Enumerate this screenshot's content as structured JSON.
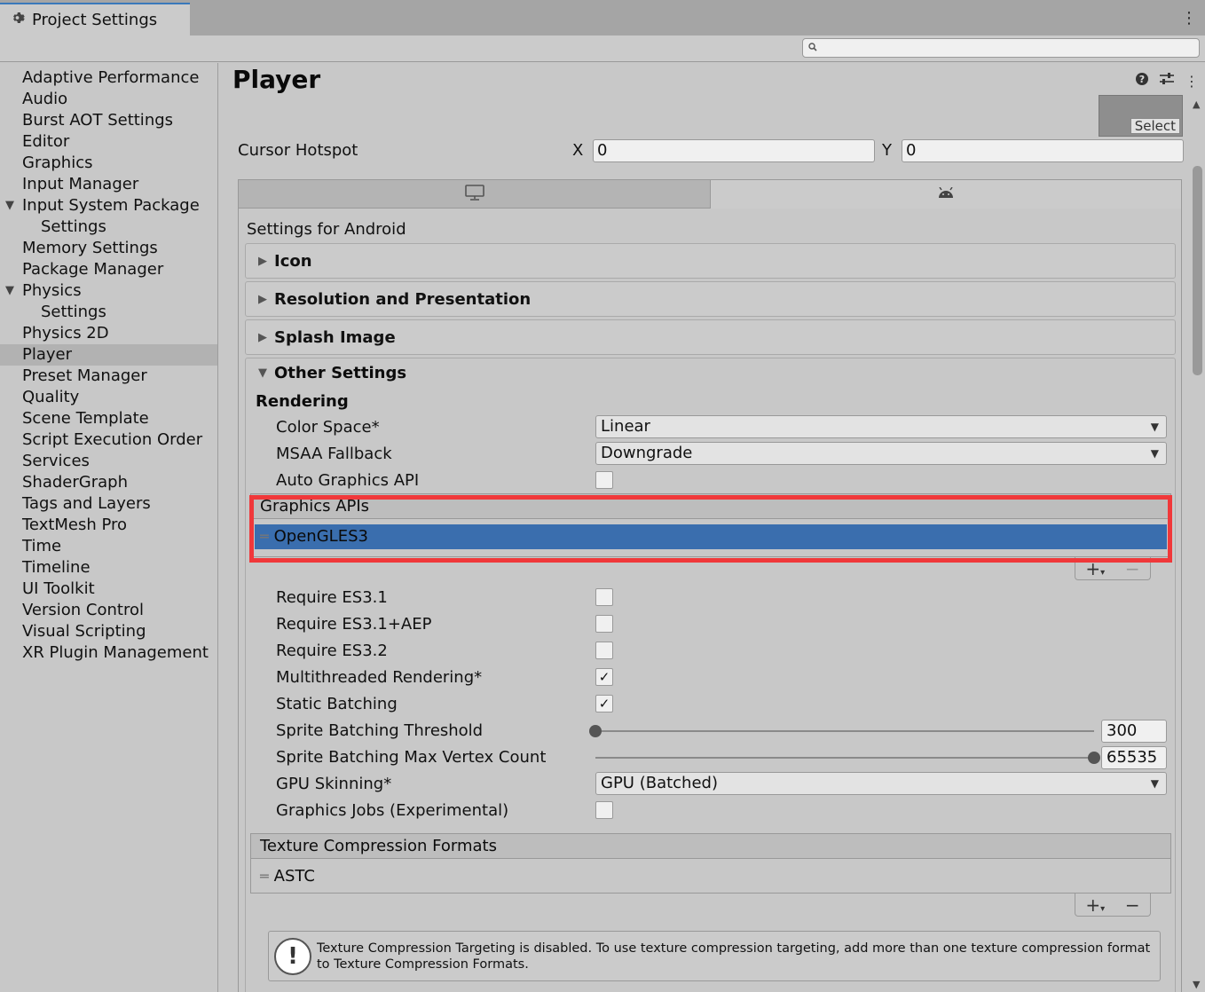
{
  "window": {
    "tab_title": "Project Settings",
    "menu_icon": "kebab-menu-icon",
    "settings_icon": "gear-icon"
  },
  "search": {
    "placeholder": "",
    "value": ""
  },
  "sidebar": {
    "items": [
      {
        "label": "Adaptive Performance"
      },
      {
        "label": "Audio"
      },
      {
        "label": "Burst AOT Settings"
      },
      {
        "label": "Editor"
      },
      {
        "label": "Graphics"
      },
      {
        "label": "Input Manager"
      },
      {
        "label": "Input System Package"
      },
      {
        "label": "Settings"
      },
      {
        "label": "Memory Settings"
      },
      {
        "label": "Package Manager"
      },
      {
        "label": "Physics"
      },
      {
        "label": "Settings"
      },
      {
        "label": "Physics 2D"
      },
      {
        "label": "Player"
      },
      {
        "label": "Preset Manager"
      },
      {
        "label": "Quality"
      },
      {
        "label": "Scene Template"
      },
      {
        "label": "Script Execution Order"
      },
      {
        "label": "Services"
      },
      {
        "label": "ShaderGraph"
      },
      {
        "label": "Tags and Layers"
      },
      {
        "label": "TextMesh Pro"
      },
      {
        "label": "Time"
      },
      {
        "label": "Timeline"
      },
      {
        "label": "UI Toolkit"
      },
      {
        "label": "Version Control"
      },
      {
        "label": "Visual Scripting"
      },
      {
        "label": "XR Plugin Management"
      }
    ]
  },
  "main": {
    "title": "Player",
    "select_label": "Select",
    "cursor_hotspot": {
      "label": "Cursor Hotspot",
      "x_label": "X",
      "x_value": "0",
      "y_label": "Y",
      "y_value": "0"
    },
    "settings_for": "Settings for Android",
    "foldouts": [
      "Icon",
      "Resolution and Presentation",
      "Splash Image"
    ],
    "other_settings": "Other Settings",
    "rendering_title": "Rendering",
    "color_space": {
      "label": "Color Space*",
      "value": "Linear"
    },
    "msaa_fallback": {
      "label": "MSAA Fallback",
      "value": "Downgrade"
    },
    "auto_graphics_api": {
      "label": "Auto Graphics API",
      "checked": false
    },
    "graphics_apis": {
      "header": "Graphics APIs",
      "items": [
        "OpenGLES3"
      ]
    },
    "require_es31": {
      "label": "Require ES3.1",
      "checked": false
    },
    "require_es31_aep": {
      "label": "Require ES3.1+AEP",
      "checked": false
    },
    "require_es32": {
      "label": "Require ES3.2",
      "checked": false
    },
    "multithreaded_rendering": {
      "label": "Multithreaded Rendering*",
      "checked": true,
      "mark": "✓"
    },
    "static_batching": {
      "label": "Static Batching",
      "checked": true,
      "mark": "✓"
    },
    "sprite_batching_threshold": {
      "label": "Sprite Batching Threshold",
      "value": "300",
      "level": 0
    },
    "sprite_batching_max_vertex": {
      "label": "Sprite Batching Max Vertex Count",
      "value": "65535",
      "level": 1
    },
    "gpu_skinning": {
      "label": "GPU Skinning*",
      "value": "GPU (Batched)"
    },
    "graphics_jobs": {
      "label": "Graphics Jobs (Experimental)",
      "checked": false
    },
    "texture_compression": {
      "header": "Texture Compression Formats",
      "items": [
        "ASTC"
      ]
    },
    "help_text": "Texture Compression Targeting is disabled. To use texture compression targeting, add more than one texture compression format to Texture Compression Formats.",
    "help_icon": "!"
  },
  "colors": {
    "selection": "#3a6eae",
    "highlight_frame": "#f0383a",
    "active_tab_accent": "#3a79bb"
  }
}
